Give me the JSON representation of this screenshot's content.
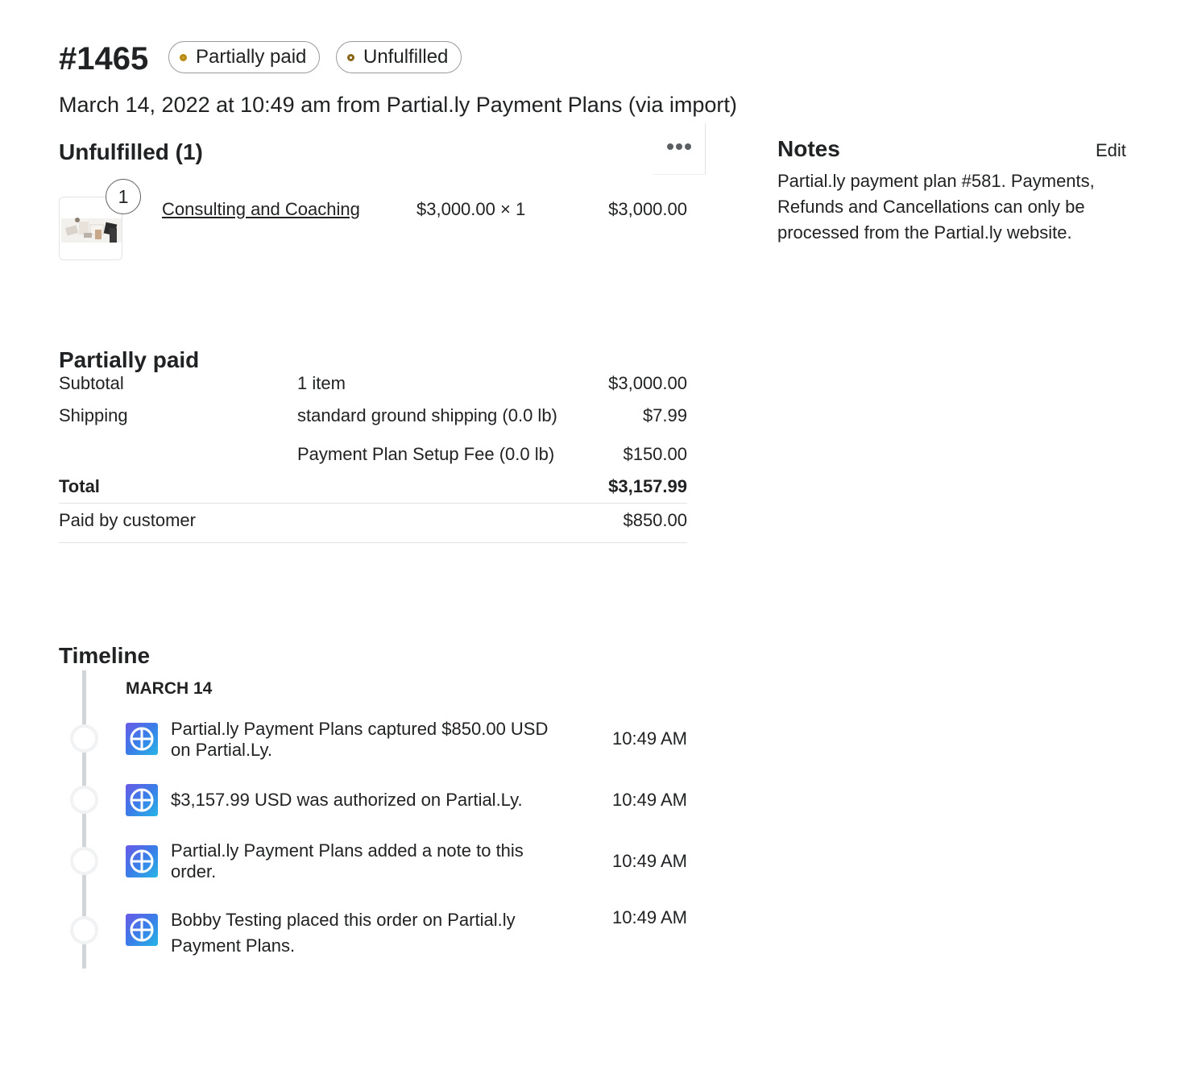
{
  "order": {
    "number": "#1465",
    "payment_status": "Partially paid",
    "fulfillment_status": "Unfulfilled",
    "subtitle": "March 14, 2022 at 10:49 am from Partial.ly Payment Plans (via import)"
  },
  "fulfillment": {
    "title": "Unfulfilled (1)",
    "items": [
      {
        "name": "Consulting and Coaching",
        "quantity_badge": "1",
        "unit_price_qty": "$3,000.00 × 1",
        "line_total": "$3,000.00"
      }
    ]
  },
  "payment": {
    "title": "Partially paid",
    "subtotal_label": "Subtotal",
    "subtotal_desc": "1 item",
    "subtotal_value": "$3,000.00",
    "shipping_label": "Shipping",
    "shipping_desc": "standard ground shipping (0.0 lb)",
    "shipping_value": "$7.99",
    "fee_desc": "Payment Plan Setup Fee (0.0 lb)",
    "fee_value": "$150.00",
    "total_label": "Total",
    "total_value": "$3,157.99",
    "paid_label": "Paid by customer",
    "paid_value": "$850.00"
  },
  "timeline": {
    "title": "Timeline",
    "date_header": "MARCH 14",
    "events": [
      {
        "text": "Partial.ly Payment Plans captured $850.00 USD on Partial.Ly.",
        "time": "10:49 AM"
      },
      {
        "text": "$3,157.99 USD was authorized on Partial.Ly.",
        "time": "10:49 AM"
      },
      {
        "text": "Partial.ly Payment Plans added a note to this order.",
        "time": "10:49 AM"
      },
      {
        "text": "Bobby Testing placed this order on Partial.ly Payment Plans.",
        "time": "10:49 AM"
      }
    ]
  },
  "notes": {
    "title": "Notes",
    "edit_label": "Edit",
    "body": "Partial.ly payment plan #581. Payments, Refunds and Cancellations can only be processed from the Partial.ly website."
  },
  "colors": {
    "partial_dot": "#c9a33a",
    "unfulfilled_dot": "#8a6516",
    "timeline_icon_start": "#6a5ae6",
    "timeline_icon_end": "#27b6e6"
  }
}
